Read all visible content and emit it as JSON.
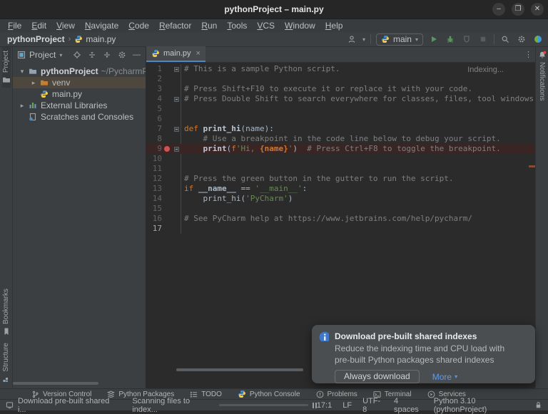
{
  "colors": {
    "accent_blue": "#4a88c7",
    "keyword_orange": "#cc7832",
    "string_green": "#6a8759",
    "comment_gray": "#7f7f7f",
    "breakpoint_red": "#d25252",
    "breakpoint_line_bg": "#3a2525",
    "run_green": "#57965c",
    "link_blue": "#5a9bf5",
    "panel_bg": "#3c3f41",
    "editor_bg": "#2b2b2b"
  },
  "titlebar": {
    "title": "pythonProject – main.py",
    "controls": [
      {
        "name": "minimize",
        "glyph": "–"
      },
      {
        "name": "restore",
        "glyph": "❐"
      },
      {
        "name": "close",
        "glyph": "✕"
      }
    ]
  },
  "menubar": {
    "items": [
      "File",
      "Edit",
      "View",
      "Navigate",
      "Code",
      "Refactor",
      "Run",
      "Tools",
      "VCS",
      "Window",
      "Help"
    ]
  },
  "toolbar": {
    "breadcrumbs": [
      {
        "label": "pythonProject",
        "bold": true
      },
      {
        "label": "main.py",
        "icon": "python-icon"
      }
    ],
    "separator": "›",
    "run_config": {
      "label": "main",
      "icon": "python-icon"
    },
    "right_icons": [
      "user-icon",
      "run-icon",
      "debug-icon",
      "coverage-icon",
      "stop-icon",
      "search-icon",
      "settings-icon",
      "pycharm-balloon-icon"
    ]
  },
  "left_stripe": {
    "top": [
      {
        "label": "Project",
        "icon": "folder-icon",
        "active": true
      }
    ],
    "bottom": [
      {
        "label": "Bookmarks",
        "icon": "bookmark-icon"
      },
      {
        "label": "Structure",
        "icon": "structure-icon"
      }
    ]
  },
  "right_stripe": {
    "items": [
      {
        "label": "Notifications",
        "icon": "bell-icon",
        "badge": true
      }
    ]
  },
  "project_panel": {
    "title": "Project",
    "title_icon": "project-view-icon",
    "dropdown_caret": "▾",
    "header_icons": [
      "locate-icon",
      "collapse-all-icon",
      "expand-all-icon",
      "settings-icon",
      "hide-icon"
    ],
    "tree": [
      {
        "label": "pythonProject",
        "suffix": " ~/PycharmPro",
        "icon": "project-folder-icon",
        "chevron": "expanded",
        "bold": true,
        "indent": 0
      },
      {
        "label": "venv",
        "icon": "excluded-folder-icon",
        "chevron": "collapsed",
        "indent": 1,
        "selected": true
      },
      {
        "label": "main.py",
        "icon": "python-icon",
        "indent": 1
      },
      {
        "label": "External Libraries",
        "icon": "libraries-icon",
        "chevron": "collapsed",
        "indent": 0
      },
      {
        "label": "Scratches and Consoles",
        "icon": "scratches-icon",
        "indent": 0
      }
    ]
  },
  "editor": {
    "tab": {
      "label": "main.py",
      "icon": "python-icon"
    },
    "indexing_label": "Indexing...",
    "current_line": 17,
    "lines": [
      {
        "n": 1,
        "fold": true,
        "segs": [
          {
            "t": "# This is a sample Python script.",
            "c": "com"
          }
        ]
      },
      {
        "n": 2,
        "segs": []
      },
      {
        "n": 3,
        "segs": [
          {
            "t": "# Press Shift+F10 to execute it or replace it with your code.",
            "c": "com"
          }
        ]
      },
      {
        "n": 4,
        "fold": true,
        "segs": [
          {
            "t": "# Press Double Shift to search everywhere for classes, files, tool windows, actions, and settings.",
            "c": "com"
          }
        ]
      },
      {
        "n": 5,
        "segs": []
      },
      {
        "n": 6,
        "segs": []
      },
      {
        "n": 7,
        "fold": true,
        "segs": [
          {
            "t": "def ",
            "c": "kw"
          },
          {
            "t": "print_hi",
            "c": "fn"
          },
          {
            "t": "(name):",
            "c": "pl"
          }
        ]
      },
      {
        "n": 8,
        "segs": [
          {
            "t": "    # Use a breakpoint in the code line below to debug your script.",
            "c": "com"
          }
        ]
      },
      {
        "n": 9,
        "fold": true,
        "breakpoint": true,
        "segs": [
          {
            "t": "    ",
            "c": "pl"
          },
          {
            "t": "print",
            "c": "fn"
          },
          {
            "t": "(",
            "c": "pl"
          },
          {
            "t": "f",
            "c": "kw"
          },
          {
            "t": "'Hi, ",
            "c": "str"
          },
          {
            "t": "{name}",
            "c": "interp"
          },
          {
            "t": "'",
            "c": "str"
          },
          {
            "t": ")  ",
            "c": "pl"
          },
          {
            "t": "# Press Ctrl+F8 to toggle the breakpoint.",
            "c": "com"
          }
        ]
      },
      {
        "n": 10,
        "segs": []
      },
      {
        "n": 11,
        "segs": []
      },
      {
        "n": 12,
        "segs": [
          {
            "t": "# Press the green button in the gutter to run the script.",
            "c": "com"
          }
        ]
      },
      {
        "n": 13,
        "segs": [
          {
            "t": "if ",
            "c": "kw"
          },
          {
            "t": "__name__ ",
            "c": "plb"
          },
          {
            "t": "== ",
            "c": "pl"
          },
          {
            "t": "'__main__'",
            "c": "str"
          },
          {
            "t": ":",
            "c": "pl"
          }
        ]
      },
      {
        "n": 14,
        "segs": [
          {
            "t": "    print_hi(",
            "c": "pl"
          },
          {
            "t": "'PyCharm'",
            "c": "str"
          },
          {
            "t": ")",
            "c": "pl"
          }
        ]
      },
      {
        "n": 15,
        "segs": []
      },
      {
        "n": 16,
        "segs": [
          {
            "t": "# See PyCharm help at https://www.jetbrains.com/help/pycharm/",
            "c": "com"
          }
        ]
      },
      {
        "n": 17,
        "segs": []
      }
    ]
  },
  "notification": {
    "icon": "info-icon",
    "title": "Download pre-built shared indexes",
    "body": "Reduce the indexing time and CPU load with pre-built Python packages shared indexes",
    "primary_button": "Always download",
    "link_button": "More",
    "link_caret": "▾"
  },
  "bottom_bar": {
    "items": [
      {
        "label": "Version Control",
        "icon": "branch-icon"
      },
      {
        "label": "Python Packages",
        "icon": "packages-icon"
      },
      {
        "label": "TODO",
        "icon": "todo-icon"
      },
      {
        "label": "Python Console",
        "icon": "python-console-icon"
      },
      {
        "label": "Problems",
        "icon": "problems-icon"
      },
      {
        "label": "Terminal",
        "icon": "terminal-icon"
      },
      {
        "label": "Services",
        "icon": "services-icon"
      }
    ]
  },
  "status_bar": {
    "event_icon": "event-log-icon",
    "message": "Download pre-built shared i...",
    "task": "Scanning files to index...",
    "progress_pct": 82,
    "pause_icon": "pause-icon",
    "caret_pos": "17:1",
    "line_sep": "LF",
    "encoding": "UTF-8",
    "indent": "4 spaces",
    "interpreter": "Python 3.10 (pythonProject)",
    "lock_icon": "lock-icon"
  }
}
